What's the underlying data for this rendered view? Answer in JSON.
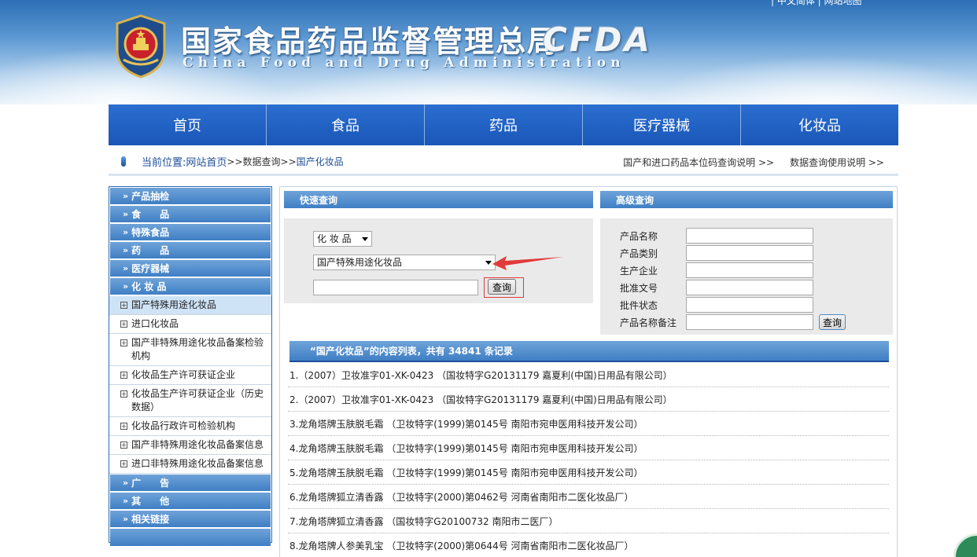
{
  "header": {
    "title": "国家食品药品监督管理总局",
    "subtitle": "China Food and Drug Administration",
    "logo_text": "CFDA",
    "top_links": "|   中文简体  |   网站地图"
  },
  "nav": [
    "首页",
    "食品",
    "药品",
    "医疗器械",
    "化妆品"
  ],
  "breadcrumb": {
    "label": "当前位置:",
    "home": "网站首页",
    "sep": ">>",
    "item1": "数据查询",
    "item2": "国产化妆品",
    "right1": "国产和进口药品本位码查询说明 >>",
    "right2": "数据查询使用说明 >>"
  },
  "sidebar": {
    "cats_top": [
      "产品抽检",
      "食　　品",
      "特殊食品",
      "药　　品",
      "医疗器械",
      "化 妆 品"
    ],
    "subs": [
      {
        "label": "国产特殊用途化妆品",
        "active": true
      },
      {
        "label": "进口化妆品",
        "active": false
      },
      {
        "label": "国产非特殊用途化妆品备案检验机构",
        "active": false
      },
      {
        "label": "化妆品生产许可获证企业",
        "active": false
      },
      {
        "label": "化妆品生产许可获证企业（历史数据）",
        "active": false
      },
      {
        "label": "化妆品行政许可检验机构",
        "active": false
      },
      {
        "label": "国产非特殊用途化妆品备案信息",
        "active": false
      },
      {
        "label": "进口非特殊用途化妆品备案信息",
        "active": false
      }
    ],
    "cats_bottom": [
      "广　　告",
      "其　　他",
      "相关链接"
    ]
  },
  "quick_search": {
    "title": "快速查询",
    "category": "化 妆 品",
    "subcategory": "国产特殊用途化妆品",
    "input_value": "",
    "button": "查询"
  },
  "advanced_search": {
    "title": "高级查询",
    "fields": [
      "产品名称",
      "产品类别",
      "生产企业",
      "批准文号",
      "批件状态",
      "产品名称备注"
    ],
    "button": "查询"
  },
  "results": {
    "header": "“国产化妆品”的内容列表，共有 34841 条记录",
    "items": [
      "1.（2007）卫妆准字01-XK-0423 （国妆特字G20131179 嘉夏利(中国)日用品有限公司）",
      "2.（2007）卫妆准字01-XK-0423 （国妆特字G20131179 嘉夏利(中国)日用品有限公司）",
      "3.龙角塔牌玉肤脱毛霜 （卫妆特字(1999)第0145号 南阳市宛申医用科技开发公司）",
      "4.龙角塔牌玉肤脱毛霜 （卫妆特字(1999)第0145号 南阳市宛申医用科技开发公司）",
      "5.龙角塔牌玉肤脱毛霜 （卫妆特字(1999)第0145号 南阳市宛申医用科技开发公司）",
      "6.龙角塔牌狐立清香露 （卫妆特字(2000)第0462号 河南省南阳市二医化妆品厂）",
      "7.龙角塔牌狐立清香露 （国妆特字G20100732 南阳市二医厂）",
      "8.龙角塔牌人参美乳宝 （卫妆特字(2000)第0644号 河南省南阳市二医化妆品厂）"
    ]
  },
  "colors": {
    "nav_blue": "#1f5fbf",
    "panel_blue": "#4f8ccc",
    "link_blue": "#1d4f9a",
    "annotation_red": "#e23a3a"
  }
}
